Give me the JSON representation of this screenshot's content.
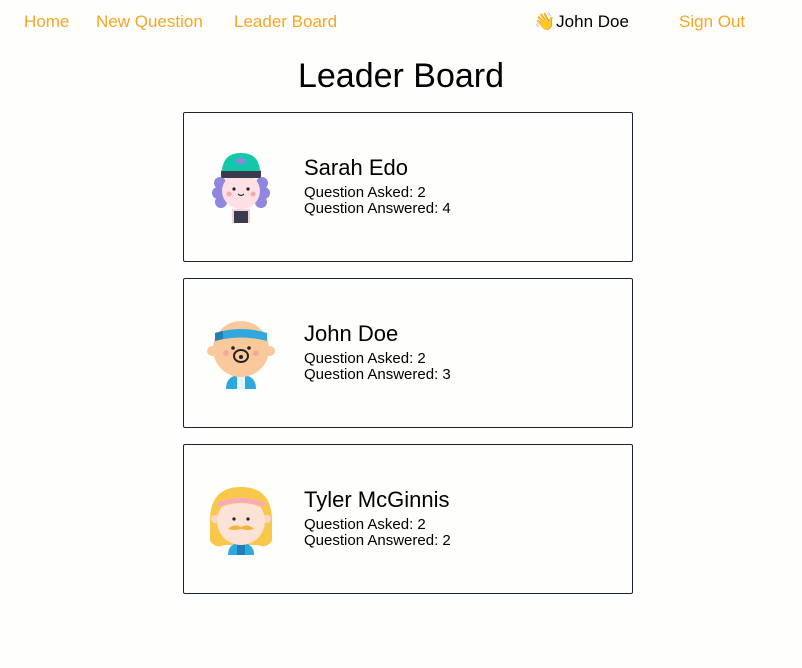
{
  "nav": {
    "home": "Home",
    "new_question": "New Question",
    "leader_board": "Leader Board",
    "user_emoji": "👋",
    "user_name": "John Doe",
    "sign_out": "Sign Out",
    "link_color": "#f5a623"
  },
  "page": {
    "title": "Leader Board"
  },
  "leaders": [
    {
      "name": "Sarah Edo",
      "asked": "Question Asked: 2",
      "answered": "Question Answered: 4",
      "avatar": "girl-teal-cap-avatar"
    },
    {
      "name": "John Doe",
      "asked": "Question Asked: 2",
      "answered": "Question Answered: 3",
      "avatar": "bald-boy-headband-avatar"
    },
    {
      "name": "Tyler McGinnis",
      "asked": "Question Asked: 2",
      "answered": "Question Answered: 2",
      "avatar": "blonde-mustache-headband-avatar"
    }
  ]
}
